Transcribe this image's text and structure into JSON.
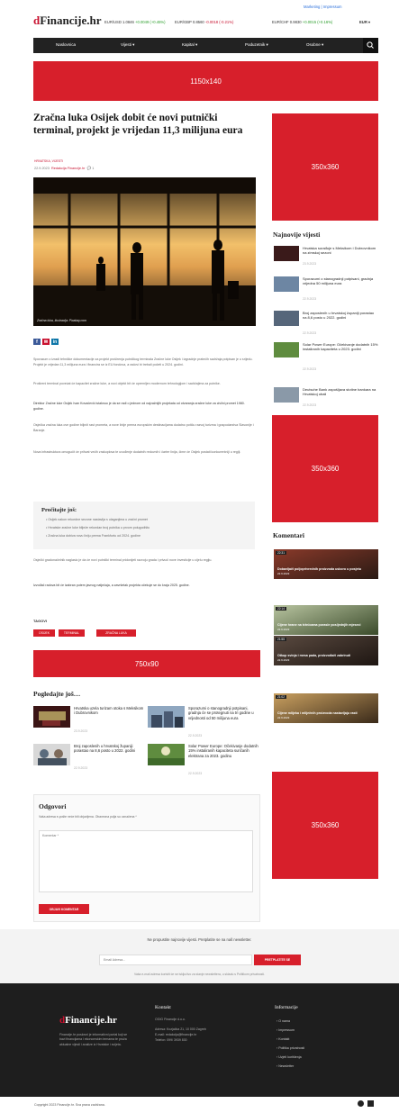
{
  "header": {
    "logo_prefix": "d",
    "logo_text": "Financije.hr",
    "top_links": "Marketing | Impressum",
    "tickers": [
      {
        "pair": "EUR/USD",
        "value": "1.0846",
        "change": "+0.0049 (+0.45%)",
        "dir": "up"
      },
      {
        "pair": "EUR/GBP",
        "value": "0.8560",
        "change": "-0.0018 (-0.21%)",
        "dir": "down"
      },
      {
        "pair": "EUR/CHF",
        "value": "0.9830",
        "change": "+0.0015 (+0.16%)",
        "dir": "up"
      }
    ],
    "lang": "EUR"
  },
  "nav": {
    "items": [
      "Naslovnica",
      "Vijesti ▾",
      "Kapital ▾",
      "Poduzetnik ▾",
      "Osobne ▾"
    ]
  },
  "ads": {
    "top": "1150x140",
    "side1": "350x360",
    "side2": "350x360",
    "mid": "750x90",
    "side3": "350x360"
  },
  "article": {
    "title": "Zračna luka Osijek dobit će novi putnički terminal, projekt je vrijedan 11,3 milijuna eura",
    "category": "HRVATSKA, VIJESTI",
    "date": "22.9.2023",
    "author": "Redakcija Financije.hr",
    "comments": "1",
    "image_caption": "Zračna luka, Ilustracija: Pixabay.com",
    "para1": "Sporazum o izradi tehničke dokumentacije za projekt proširenja putničkog terminala Zračne luke Osijek i izgradnje pratećih sadržaja potpisan je u srijedu. Projekt je vrijedan 11,3 milijuna eura i financira se iz EU fondova, a radovi bi trebali početi u 2024. godini.",
    "para2": "Prošireni terminal povećat će kapacitet zračne luke, a novi objekt bit će opremljen modernom tehnologijom i sadržajima za putnike.",
    "para3": "Direktor Zračne luke Osijek Ivan Kovačević istaknuo je da se radi o jednom od najvažnijih projekata od otvaranja zračne luke za civilni promet 1980. godine.",
    "para4": "Osječka zračna luka ove godine bilježi rast prometa, a nove linije prema europskim destinacijama dodatno potiču razvoj turizma i gospodarstva Slavonije i Baranje.",
    "para5": "Nova infrastruktura omogućit će prihvat većih zrakoplova te uvođenje dodatnih redovnih i čarter linija, čime će Osijek postati konkurentniji u regiji.",
    "box_title": "Pročitajte još:",
    "box_links": [
      "Osijek nakon rekordne sezone nastavlja s ulaganjima u zračni promet",
      "Hrvatske zračne luke bilježe rekordan broj putnika u prvom polugodištu",
      "Zračna luka dobiva novu liniju prema Frankfurtu od 2024. godine"
    ],
    "para6": "Osječki gradonačelnik naglasio je da će novi putnički terminal pridonijeti razvoju grada i privući nove investicije u cijelu regiju.",
    "para7": "Izvođač radova bit će izabran putem javnog natječaja, a završetak projekta očekuje se do kraja 2025. godine.",
    "tags_label": "TAGOVI",
    "tags": [
      "OSIJEK",
      "TERMINAL",
      "ZRAČNA LUKA"
    ]
  },
  "related": {
    "heading": "Pogledajte još…",
    "items": [
      {
        "title": "Hrvatska uzela turizam otoka s Meksikom i Dubrovnikom",
        "date": "23.9.2023"
      },
      {
        "title": "Sporazumi o stanogradnji potpisani, gradnja će se protegnuti na tri godine u vrijednosti od 50 milijuna eura",
        "date": "22.9.2023"
      },
      {
        "title": "Broj zaposlenih u hrvatskoj županiji porastao na 8,6 posto u 2022. godini",
        "date": "22.9.2023"
      },
      {
        "title": "Solar Power Europe: Očekivanje dodatnih 15% instaliranih kapaciteta sunčanih elektrana za 2023. godinu",
        "date": "22.9.2023"
      }
    ]
  },
  "reply": {
    "heading": "Odgovori",
    "note": "Vaša adresa e-pošte neće biti objavljena. Obavezna polja su označena *",
    "textarea_placeholder": "Komentar *",
    "button": "OBJAVI KOMENTAR"
  },
  "sidebar": {
    "news_heading": "Najnovije vijesti",
    "news": [
      {
        "title": "Hrvatska surađuje s Meksikom i Dubrovnikom na zimskoj sezoni",
        "date": "23.9.2023"
      },
      {
        "title": "Sporazumi o stanogradnji potpisani, gradnja vrijedna 50 milijuna eura",
        "date": "22.9.2023"
      },
      {
        "title": "Broj zaposlenih u hrvatskoj županiji porastao na 8,6 posto u 2022. godini",
        "date": "22.9.2023"
      },
      {
        "title": "Solar Power Europe: Očekivanje dodatnih 15% instaliranih kapaciteta u 2023. godini",
        "date": "22.9.2023"
      },
      {
        "title": "Deutsche Bank zapošljava stotine bankara na Hrvatskoj obali",
        "date": "22.9.2023"
      }
    ],
    "comments_heading": "Komentari",
    "comments": [
      {
        "time": "22:31",
        "title": "Dobavljači poljoprivrednih proizvoda uskoro u posjetu",
        "date": "22.9.2023"
      },
      {
        "time": "22:14",
        "title": "Cijene hrane na tržnicama porasle posljednjih mjeseci",
        "date": "22.9.2023"
      },
      {
        "time": "21:55",
        "title": "Otkup svinja i mesa pada, proizvođači zabrinuti",
        "date": "22.9.2023"
      },
      {
        "time": "21:02",
        "title": "Cijene mlijeka i mliječnih proizvoda nastavljaju rasti",
        "date": "22.9.2023"
      }
    ]
  },
  "newsletter": {
    "text": "Ne propustite najnovije vijesti. Pretplatite se na naš newsletter.",
    "placeholder": "Email Adresa...",
    "button": "PRETPLATITE SE",
    "fine": "Vaša e-mail adresa koristit će se isključivo za slanje newslettera, u skladu s Politikom privatnosti."
  },
  "footer": {
    "logo_prefix": "d",
    "logo_text": "Financije.hr",
    "about": "Financije.hr poslovni je informativni portal koji se bavi financijama i ekonomskim temama te pruža aktualne vijesti i analize iz Hrvatske i svijeta.",
    "contact_heading": "Kontakt",
    "contact_lines": [
      "OGIG Financije d.o.o.",
      "Adresa: Kozjačka 21, 10 000 Zagreb",
      "E-mail: redakcija@financije.hr",
      "Telefon: 099/ 3939 830"
    ],
    "info_heading": "Informacije",
    "info_links": [
      "O nama",
      "Impressum",
      "Kontakt",
      "Politika privatnosti",
      "Uvjeti korištenja",
      "Newsletter"
    ],
    "copyright": "Copyright 2023 Financije.hr. Sva prava zadržana."
  },
  "colors": {
    "accent": "#d71f2b",
    "dark": "#222222"
  }
}
